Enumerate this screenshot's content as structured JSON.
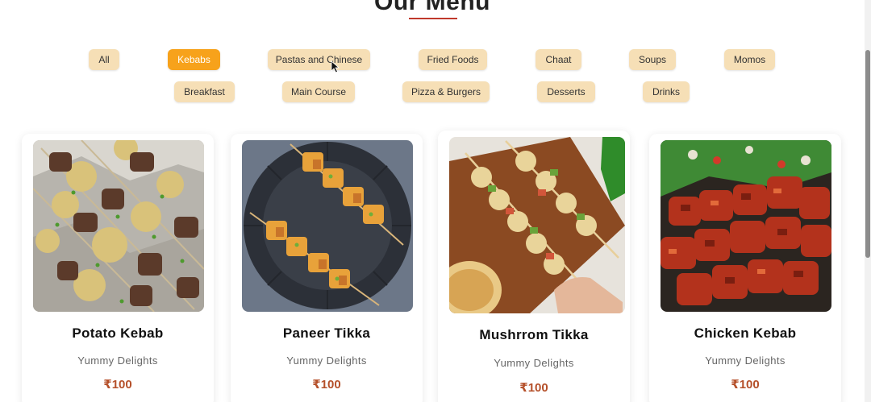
{
  "menu": {
    "heading": "Our Menu"
  },
  "filters": {
    "all": "All",
    "kebabs": "Kebabs",
    "pastas": "Pastas and Chinese",
    "fried": "Fried Foods",
    "chaat": "Chaat",
    "soups": "Soups",
    "momos": "Momos",
    "breakfast": "Breakfast",
    "main_course": "Main Course",
    "pizza": "Pizza & Burgers",
    "desserts": "Desserts",
    "drinks": "Drinks",
    "active": "Kebabs"
  },
  "items": [
    {
      "name": "Potato Kebab",
      "subtitle": "Yummy Delights",
      "price": "₹100"
    },
    {
      "name": "Paneer Tikka",
      "subtitle": "Yummy Delights",
      "price": "₹100"
    },
    {
      "name": "Mushrrom Tikka",
      "subtitle": "Yummy Delights",
      "price": "₹100"
    },
    {
      "name": "Chicken Kebab",
      "subtitle": "Yummy Delights",
      "price": "₹100"
    }
  ],
  "colors": {
    "accent": "#f7a21b",
    "chip": "#f6dfb6",
    "price": "#b5502a",
    "underline": "#c0392b"
  }
}
